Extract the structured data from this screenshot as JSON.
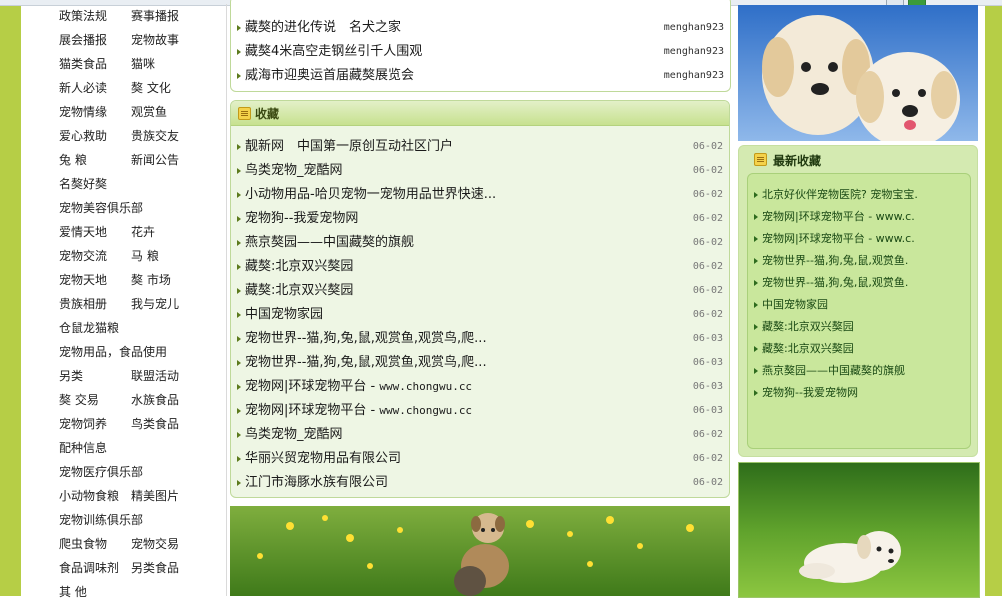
{
  "left_nav": {
    "rows": [
      [
        "政策法规",
        "赛事播报"
      ],
      [
        "展会播报",
        "宠物故事"
      ],
      [
        "猫类食品",
        "猫咪"
      ],
      [
        "新人必读",
        "獒 文化"
      ],
      [
        "宠物情缘",
        "观赏鱼"
      ],
      [
        "爱心救助",
        "贵族交友"
      ],
      [
        "兔 粮",
        "新闻公告"
      ],
      [
        "名獒好獒",
        ""
      ],
      [
        "宠物美容俱乐部",
        ""
      ],
      [
        "爱情天地",
        "花卉"
      ],
      [
        "宠物交流",
        "马 粮"
      ],
      [
        "宠物天地",
        "獒 市场"
      ],
      [
        "贵族相册",
        "我与宠儿"
      ],
      [
        "仓鼠龙猫粮",
        ""
      ],
      [
        "宠物用品，食品使用",
        ""
      ],
      [
        "另类",
        "联盟活动"
      ],
      [
        "獒 交易",
        "水族食品"
      ],
      [
        "宠物饲养",
        "鸟类食品"
      ],
      [
        "配种信息",
        ""
      ],
      [
        "宠物医疗俱乐部",
        ""
      ],
      [
        "小动物食粮",
        "精美图片"
      ],
      [
        "宠物训练俱乐部",
        ""
      ],
      [
        "爬虫食物",
        "宠物交易"
      ],
      [
        "食品调味剂",
        "另类食品"
      ],
      [
        "其 他",
        ""
      ]
    ]
  },
  "top_list": {
    "items": [
      {
        "title": "藏獒的进化传说　名犬之家",
        "author": "menghan923"
      },
      {
        "title": "藏獒4米高空走钢丝引千人围观",
        "author": "menghan923"
      },
      {
        "title": "威海市迎奥运首届藏獒展览会",
        "author": "menghan923"
      }
    ]
  },
  "favorites": {
    "title": "收藏",
    "items": [
      {
        "title": "靓新网　中国第一原创互动社区门户",
        "date": "06-02"
      },
      {
        "title": "鸟类宠物_宠酷网",
        "date": "06-02"
      },
      {
        "title": "小动物用品-哈贝宠物一宠物用品世界快速...",
        "date": "06-02"
      },
      {
        "title": "宠物狗--我爱宠物网",
        "date": "06-02"
      },
      {
        "title": "燕京獒园——中国藏獒的旗舰",
        "date": "06-02"
      },
      {
        "title": "藏獒:北京双兴獒园",
        "date": "06-02"
      },
      {
        "title": "藏獒:北京双兴獒园",
        "date": "06-02"
      },
      {
        "title": "中国宠物家园",
        "date": "06-02"
      },
      {
        "title": "宠物世界--猫,狗,兔,鼠,观赏鱼,观赏鸟,爬...",
        "date": "06-03"
      },
      {
        "title": "宠物世界--猫,狗,兔,鼠,观赏鱼,观赏鸟,爬...",
        "date": "06-03"
      },
      {
        "title": "宠物网|环球宠物平台 - ",
        "url": "www.chongwu.cc",
        "date": "06-03"
      },
      {
        "title": "宠物网|环球宠物平台 - ",
        "url": "www.chongwu.cc",
        "date": "06-03"
      },
      {
        "title": "鸟类宠物_宠酷网",
        "date": "06-02"
      },
      {
        "title": "华丽兴贸宠物用品有限公司",
        "date": "06-02"
      },
      {
        "title": "江门市海豚水族有限公司",
        "date": "06-02"
      }
    ]
  },
  "latest": {
    "title": "最新收藏",
    "items": [
      "北京好伙伴宠物医院? 宠物宝宝.",
      "宠物网|环球宠物平台 - www.c.",
      "宠物网|环球宠物平台 - www.c.",
      "宠物世界--猫,狗,兔,鼠,观赏鱼.",
      "宠物世界--猫,狗,兔,鼠,观赏鱼.",
      "中国宠物家园",
      "藏獒:北京双兴獒园",
      "藏獒:北京双兴獒园",
      "燕京獒园——中国藏獒的旗舰",
      "宠物狗--我爱宠物网"
    ]
  },
  "colors": {
    "accent_green": "#b6ce46",
    "panel_bg": "#eef6e4",
    "sidebox_bg": "#c9e79c"
  }
}
